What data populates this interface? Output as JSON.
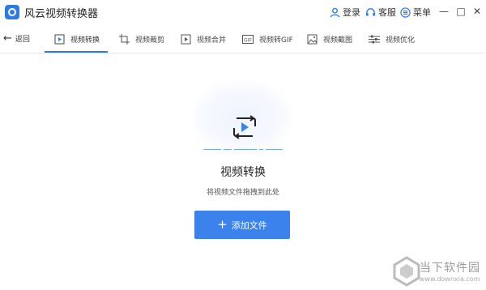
{
  "app": {
    "title": "风云视频转换器"
  },
  "titlebar": {
    "login_label": "登录",
    "service_label": "客服",
    "menu_label": "菜单",
    "minimize_symbol": "—",
    "maximize_symbol": "□",
    "close_symbol": "✕"
  },
  "nav": {
    "back_label": "返回",
    "tabs": [
      {
        "label": "视频转换",
        "icon": "video-play-icon",
        "active": true
      },
      {
        "label": "视频裁剪",
        "icon": "video-crop-icon"
      },
      {
        "label": "视频合并",
        "icon": "video-merge-icon"
      },
      {
        "label": "视频转GIF",
        "icon": "gif-icon"
      },
      {
        "label": "视频截图",
        "icon": "image-icon"
      },
      {
        "label": "视频优化",
        "icon": "sliders-icon"
      }
    ]
  },
  "main": {
    "title": "视频转换",
    "subtitle": "将视频文件拖拽到此处",
    "add_button_label": "添加文件"
  },
  "watermark": {
    "name": "当下软件园",
    "url": "www.downxia.com"
  },
  "colors": {
    "accent": "#2f7be5",
    "button": "#3c82ec"
  }
}
